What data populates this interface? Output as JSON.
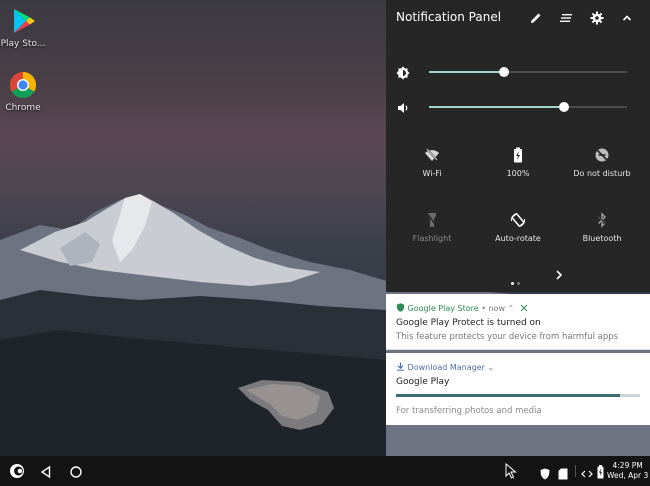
{
  "desktop": {
    "icons": [
      {
        "label": "Play Sto...",
        "icon": "play-store-icon"
      },
      {
        "label": "Chrome",
        "icon": "chrome-icon"
      }
    ]
  },
  "panel": {
    "title": "Notification Panel",
    "header_icons": [
      "edit-icon",
      "sort-icon",
      "gear-icon",
      "chevron-up-icon"
    ],
    "brightness": {
      "icon": "brightness-icon",
      "level": 0.38
    },
    "volume": {
      "icon": "volume-icon",
      "level": 0.68
    },
    "tiles": [
      {
        "label": "Wi-Fi",
        "icon": "wifi-off-icon",
        "active": true
      },
      {
        "label": "100%",
        "icon": "battery-charging-icon",
        "active": true
      },
      {
        "label": "Do not disturb",
        "icon": "do-not-disturb-icon",
        "active": true
      },
      {
        "label": "Flashlight",
        "icon": "flashlight-icon",
        "active": false
      },
      {
        "label": "Auto-rotate",
        "icon": "auto-rotate-icon",
        "active": true
      },
      {
        "label": "Bluetooth",
        "icon": "bluetooth-icon",
        "active": true
      }
    ],
    "page_count": 2,
    "current_page": 1
  },
  "notifications": [
    {
      "app": "Google Play Store",
      "meta": "• now ⌃",
      "title": "Google Play Protect is turned on",
      "text": "This feature protects your device from harmful apps"
    },
    {
      "app": "Download Manager",
      "meta": "⌄",
      "title": "Google Play",
      "progress": 0.92,
      "text": "For transferring photos and media"
    }
  ],
  "taskbar": {
    "time": "4:29 PM",
    "date": "Wed, Apr 3",
    "icons": [
      "launcher-icon",
      "back-icon",
      "home-icon",
      "cursor-icon",
      "shield-icon",
      "sd-card-icon",
      "code-icon",
      "battery-icon"
    ]
  },
  "colors": {
    "panel_bg": "#262626",
    "slider_fill": "#9fd5cc",
    "accent_green": "#2e8b57",
    "progress_fill": "#3a6e70",
    "taskbar_bg": "#131313"
  }
}
